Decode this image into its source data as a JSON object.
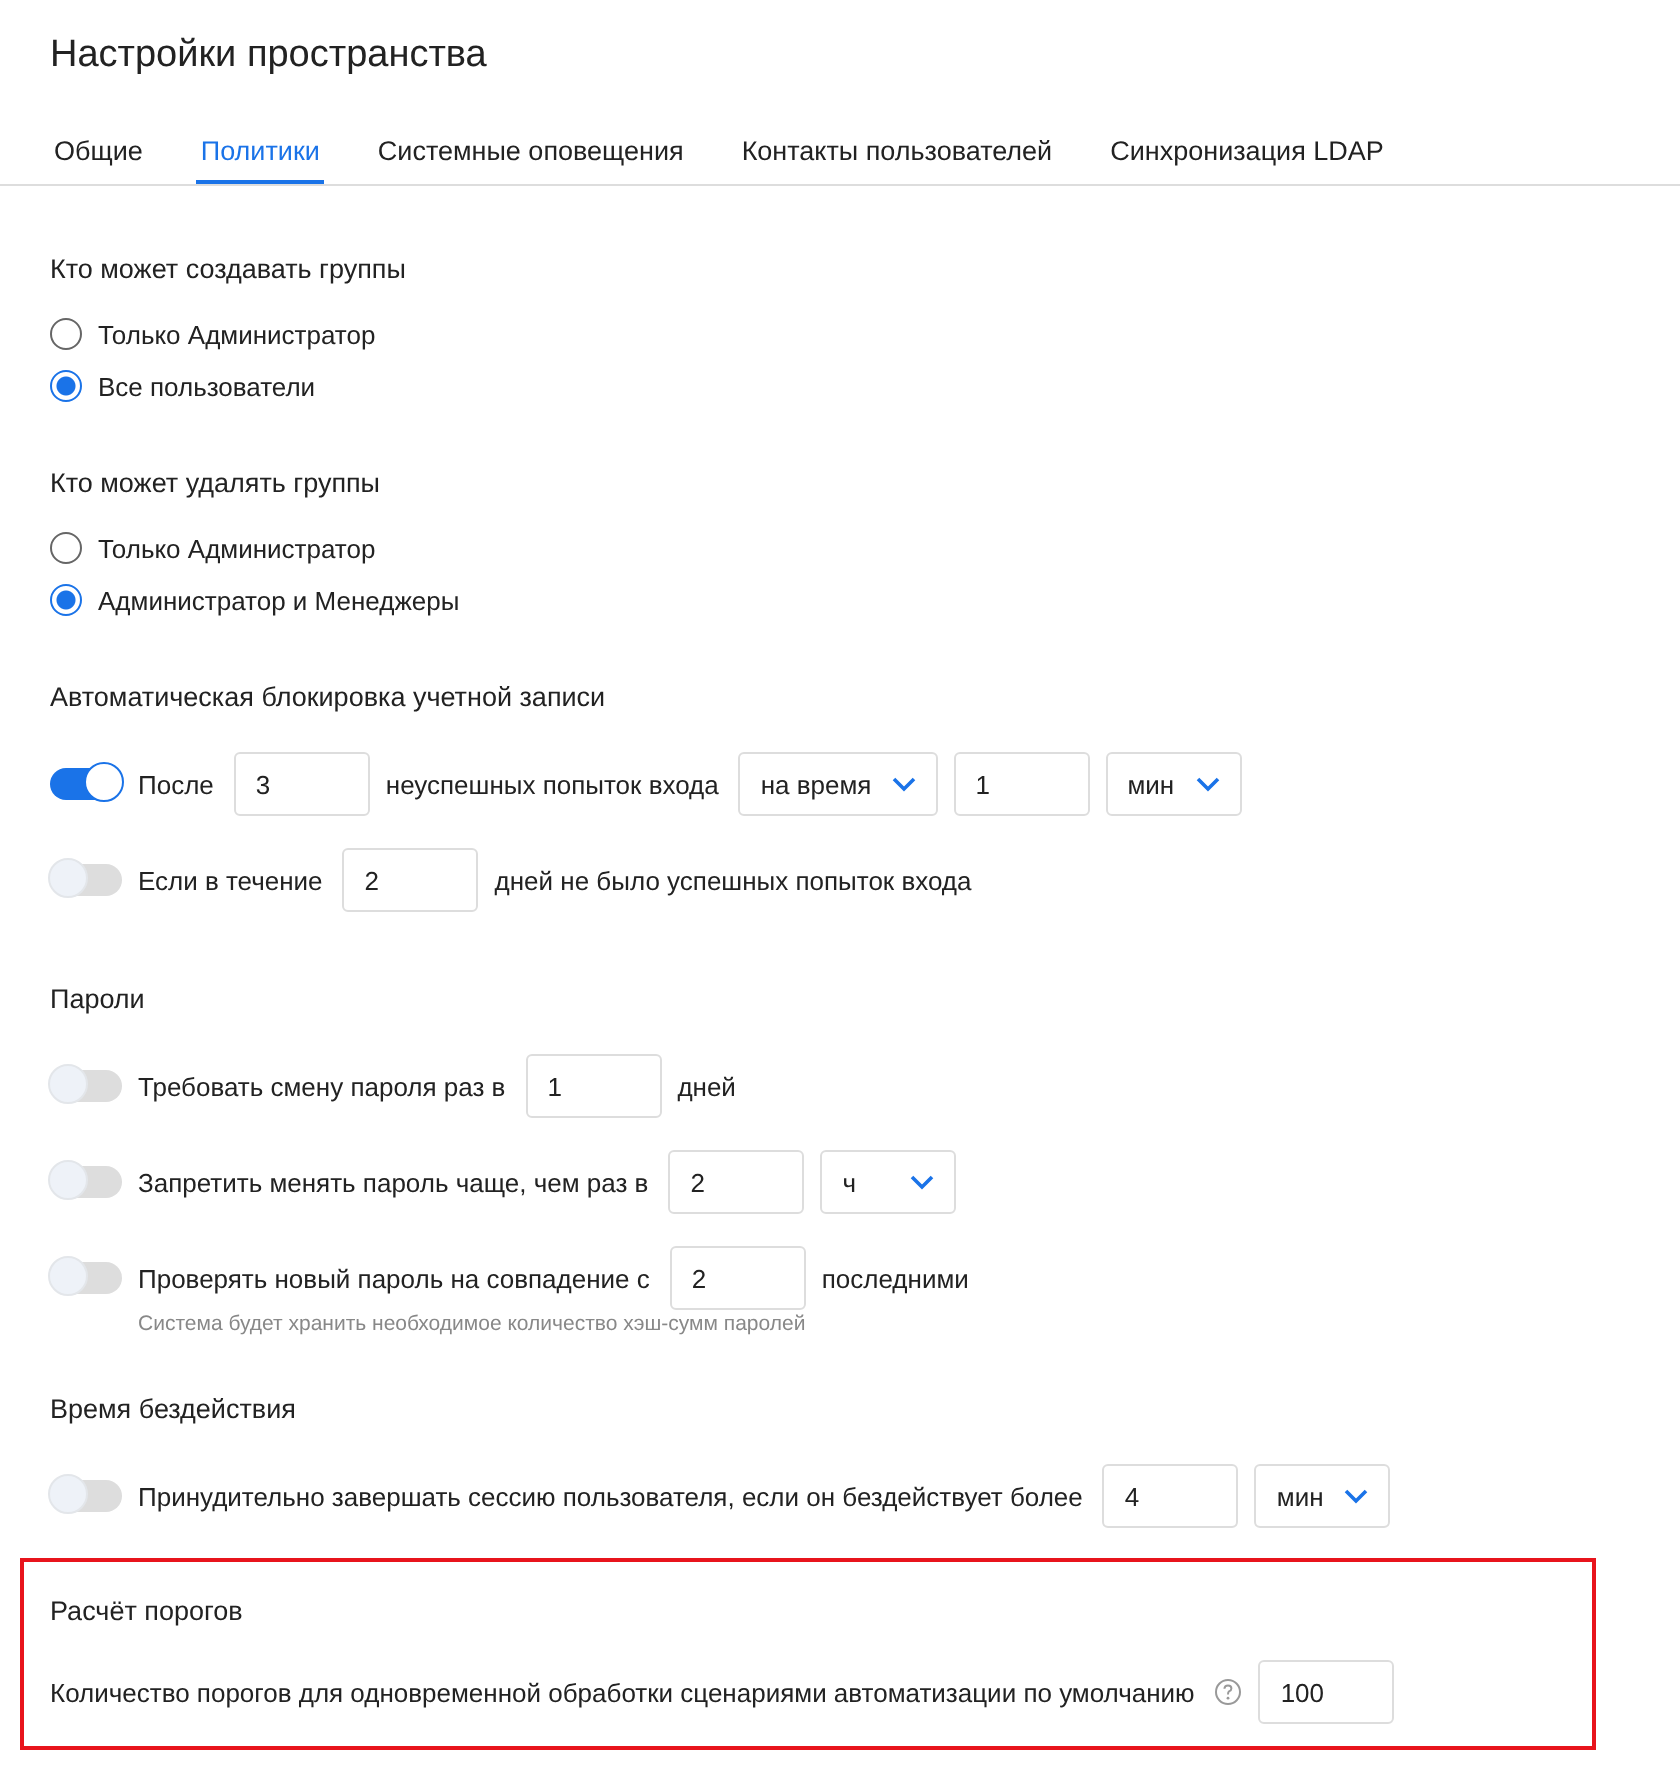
{
  "title": "Настройки пространства",
  "tabs": [
    {
      "label": "Общие",
      "selected": false
    },
    {
      "label": "Политики",
      "selected": true
    },
    {
      "label": "Системные оповещения",
      "selected": false
    },
    {
      "label": "Контакты пользователей",
      "selected": false
    },
    {
      "label": "Синхронизация LDAP",
      "selected": false
    }
  ],
  "sections": [
    {
      "heading": "Кто может создавать группы",
      "highlighted": false,
      "rows": [
        {
          "kind": "radio",
          "selected": false,
          "parts": [
            {
              "kind": "text",
              "text": "Только Администратор"
            }
          ]
        },
        {
          "kind": "radio",
          "selected": true,
          "parts": [
            {
              "kind": "text",
              "text": "Все пользователи"
            }
          ]
        }
      ]
    },
    {
      "heading": "Кто может удалять группы",
      "highlighted": false,
      "rows": [
        {
          "kind": "radio",
          "selected": false,
          "parts": [
            {
              "kind": "text",
              "text": "Только Администратор"
            }
          ]
        },
        {
          "kind": "radio",
          "selected": true,
          "parts": [
            {
              "kind": "text",
              "text": "Администратор и Менеджеры"
            }
          ]
        }
      ]
    },
    {
      "heading": "Автоматическая блокировка учетной записи",
      "highlighted": false,
      "rows": [
        {
          "kind": "toggle",
          "on": true,
          "parts": [
            {
              "kind": "text",
              "text": "После"
            },
            {
              "kind": "input",
              "value": "3"
            },
            {
              "kind": "text",
              "text": "неуспешных попыток входа"
            },
            {
              "kind": "select",
              "value": "на время"
            },
            {
              "kind": "input",
              "value": "1"
            },
            {
              "kind": "select",
              "value": "мин"
            }
          ]
        },
        {
          "kind": "toggle",
          "on": false,
          "parts": [
            {
              "kind": "text",
              "text": "Если в течение"
            },
            {
              "kind": "input",
              "value": "2"
            },
            {
              "kind": "text",
              "text": "дней не было успешных попыток входа"
            }
          ]
        }
      ]
    },
    {
      "heading": "Пароли",
      "highlighted": false,
      "rows": [
        {
          "kind": "toggle",
          "on": false,
          "parts": [
            {
              "kind": "text",
              "text": "Требовать смену пароля раз в"
            },
            {
              "kind": "input",
              "value": "1"
            },
            {
              "kind": "text",
              "text": "дней"
            }
          ]
        },
        {
          "kind": "toggle",
          "on": false,
          "parts": [
            {
              "kind": "text",
              "text": "Запретить менять пароль чаще, чем раз в"
            },
            {
              "kind": "input",
              "value": "2"
            },
            {
              "kind": "select",
              "value": "ч"
            }
          ]
        },
        {
          "kind": "toggle",
          "on": false,
          "hint": "Система будет хранить необходимое количество хэш-сумм паролей",
          "parts": [
            {
              "kind": "text",
              "text": "Проверять новый пароль на совпадение с"
            },
            {
              "kind": "input",
              "value": "2"
            },
            {
              "kind": "text",
              "text": "последними"
            }
          ]
        }
      ]
    },
    {
      "heading": "Время бездействия",
      "highlighted": false,
      "rows": [
        {
          "kind": "toggle",
          "on": false,
          "parts": [
            {
              "kind": "text",
              "text": "Принудительно завершать сессию пользователя, если он бездействует более"
            },
            {
              "kind": "input",
              "value": "4"
            },
            {
              "kind": "select",
              "value": "мин"
            }
          ]
        }
      ]
    },
    {
      "heading": "Расчёт порогов",
      "highlighted": true,
      "rows": [
        {
          "kind": "plain",
          "parts": [
            {
              "kind": "text",
              "text": "Количество порогов для одновременной обработки сценариями автоматизации по умолчанию"
            },
            {
              "kind": "help"
            },
            {
              "kind": "input",
              "value": "100"
            }
          ]
        }
      ]
    }
  ]
}
